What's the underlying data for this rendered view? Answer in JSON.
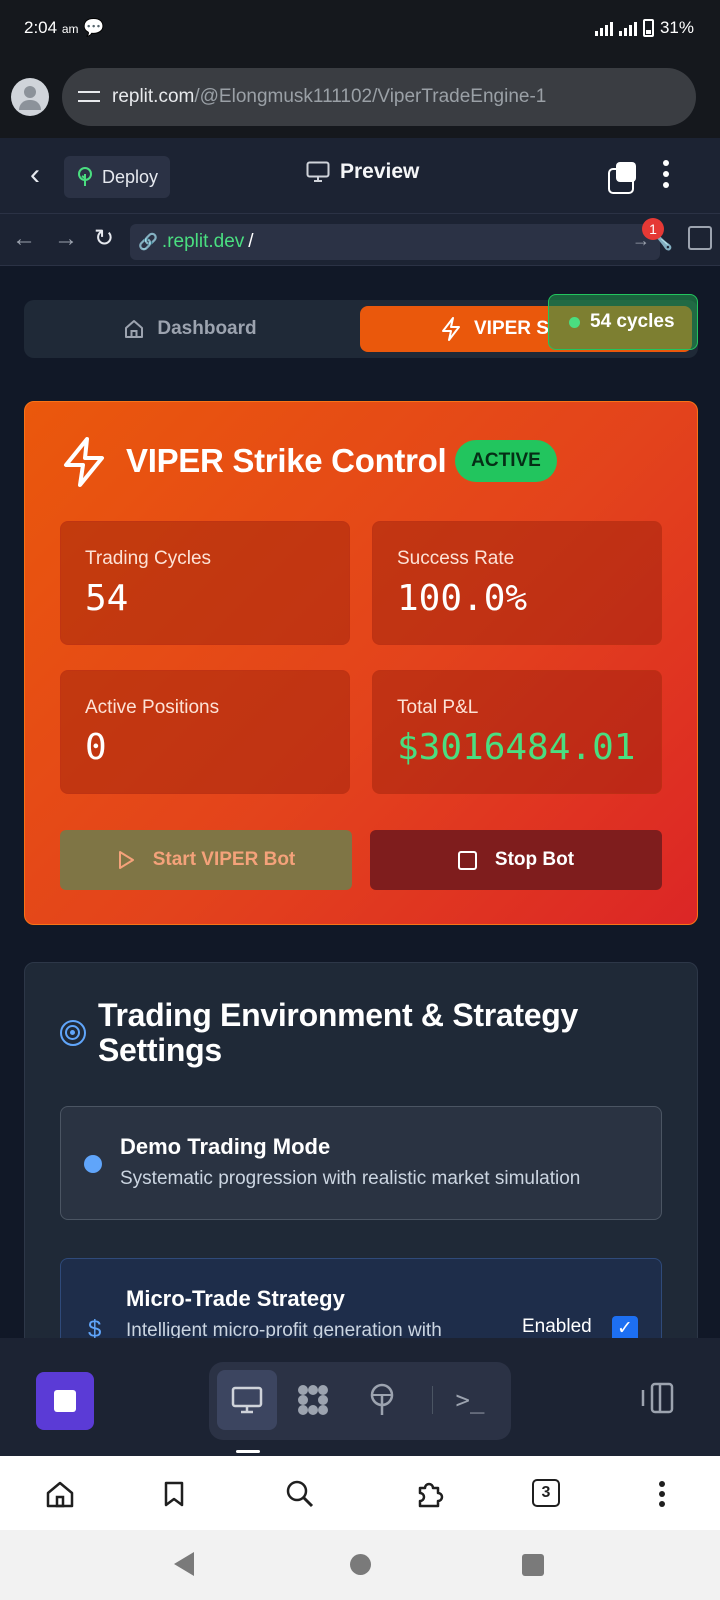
{
  "status_bar": {
    "time": "2:04",
    "ampm": "am",
    "battery": "31%"
  },
  "browser": {
    "url_host": "replit.com",
    "url_path": "/@Elongmusk111102/ViperTradeEngine-1"
  },
  "replit_header": {
    "deploy_label": "Deploy",
    "preview_label": "Preview"
  },
  "nav_row": {
    "url_host": ".replit.dev",
    "url_path": "/",
    "wrench_badge": "1"
  },
  "app": {
    "tabs": {
      "dashboard": "Dashboard",
      "viper": "VIPER S"
    },
    "cycles_badge": "54 cycles",
    "strike": {
      "title": "VIPER Strike Control",
      "status": "ACTIVE",
      "stats": [
        {
          "label": "Trading Cycles",
          "value": "54"
        },
        {
          "label": "Success Rate",
          "value": "100.0%"
        },
        {
          "label": "Active Positions",
          "value": "0"
        },
        {
          "label": "Total P&L",
          "value": "$3016484.01"
        }
      ],
      "start_label": "Start VIPER Bot",
      "stop_label": "Stop Bot"
    },
    "settings": {
      "title": "Trading Environment & Strategy Settings",
      "demo": {
        "title": "Demo Trading Mode",
        "desc": "Systematic progression with realistic market simulation"
      },
      "micro": {
        "title": "Micro-Trade Strategy",
        "desc": "Intelligent micro-profit generation with",
        "toggle_label": "Enabled",
        "enabled": true
      }
    }
  },
  "browser_bottom": {
    "tab_count": "3"
  },
  "colors": {
    "accent": "#ea580c",
    "active": "#22c55e",
    "profit": "#4ade80",
    "danger": "#7f1d1d",
    "replit_purple": "#5b3bd6"
  }
}
